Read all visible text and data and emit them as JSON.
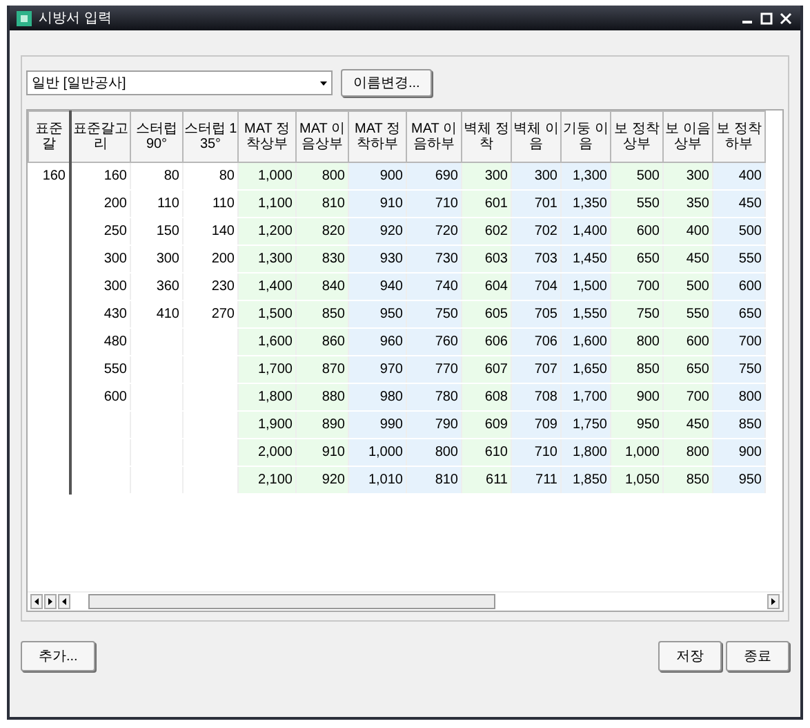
{
  "window": {
    "title": "시방서 입력"
  },
  "combo": {
    "value": "일반 [일반공사]"
  },
  "rename_button": "이름변경...",
  "table": {
    "columns": [
      {
        "label": "표준갈"
      },
      {
        "label": "표준갈고리"
      },
      {
        "label": "스터럽 90°"
      },
      {
        "label": "스터럽 135°"
      },
      {
        "label": "MAT 정착상부",
        "color": "#eafbea"
      },
      {
        "label": "MAT 이음상부",
        "color": "#eafbea"
      },
      {
        "label": "MAT 정착하부",
        "color": "#e6f2fc"
      },
      {
        "label": "MAT 이음하부",
        "color": "#e6f2fc"
      },
      {
        "label": "벽체 정착",
        "color": "#eafbea"
      },
      {
        "label": "벽체 이음",
        "color": "#e6f2fc"
      },
      {
        "label": "기둥 이음",
        "color": "#e6f2fc"
      },
      {
        "label": "보 정착상부",
        "color": "#eafbea"
      },
      {
        "label": "보 이음상부",
        "color": "#eafbea"
      },
      {
        "label": "보 정착하부",
        "color": "#e6f2fc"
      }
    ],
    "rows": [
      [
        "160",
        "160",
        "80",
        "80",
        "1,000",
        "800",
        "900",
        "690",
        "300",
        "300",
        "1,300",
        "500",
        "300",
        "400"
      ],
      [
        null,
        "200",
        "110",
        "110",
        "1,100",
        "810",
        "910",
        "710",
        "601",
        "701",
        "1,350",
        "550",
        "350",
        "450"
      ],
      [
        null,
        "250",
        "150",
        "140",
        "1,200",
        "820",
        "920",
        "720",
        "602",
        "702",
        "1,400",
        "600",
        "400",
        "500"
      ],
      [
        null,
        "300",
        "300",
        "200",
        "1,300",
        "830",
        "930",
        "730",
        "603",
        "703",
        "1,450",
        "650",
        "450",
        "550"
      ],
      [
        null,
        "300",
        "360",
        "230",
        "1,400",
        "840",
        "940",
        "740",
        "604",
        "704",
        "1,500",
        "700",
        "500",
        "600"
      ],
      [
        null,
        "430",
        "410",
        "270",
        "1,500",
        "850",
        "950",
        "750",
        "605",
        "705",
        "1,550",
        "750",
        "550",
        "650"
      ],
      [
        null,
        "480",
        null,
        null,
        "1,600",
        "860",
        "960",
        "760",
        "606",
        "706",
        "1,600",
        "800",
        "600",
        "700"
      ],
      [
        null,
        "550",
        null,
        null,
        "1,700",
        "870",
        "970",
        "770",
        "607",
        "707",
        "1,650",
        "850",
        "650",
        "750"
      ],
      [
        null,
        "600",
        null,
        null,
        "1,800",
        "880",
        "980",
        "780",
        "608",
        "708",
        "1,700",
        "900",
        "700",
        "800"
      ],
      [
        null,
        null,
        null,
        null,
        "1,900",
        "890",
        "990",
        "790",
        "609",
        "709",
        "1,750",
        "950",
        "450",
        "850"
      ],
      [
        null,
        null,
        null,
        null,
        "2,000",
        "910",
        "1,000",
        "800",
        "610",
        "710",
        "1,800",
        "1,000",
        "800",
        "900"
      ],
      [
        null,
        null,
        null,
        null,
        "2,100",
        "920",
        "1,010",
        "810",
        "611",
        "711",
        "1,850",
        "1,050",
        "850",
        "950"
      ]
    ]
  },
  "buttons": {
    "add": "추가...",
    "save": "저장",
    "close": "종료"
  }
}
